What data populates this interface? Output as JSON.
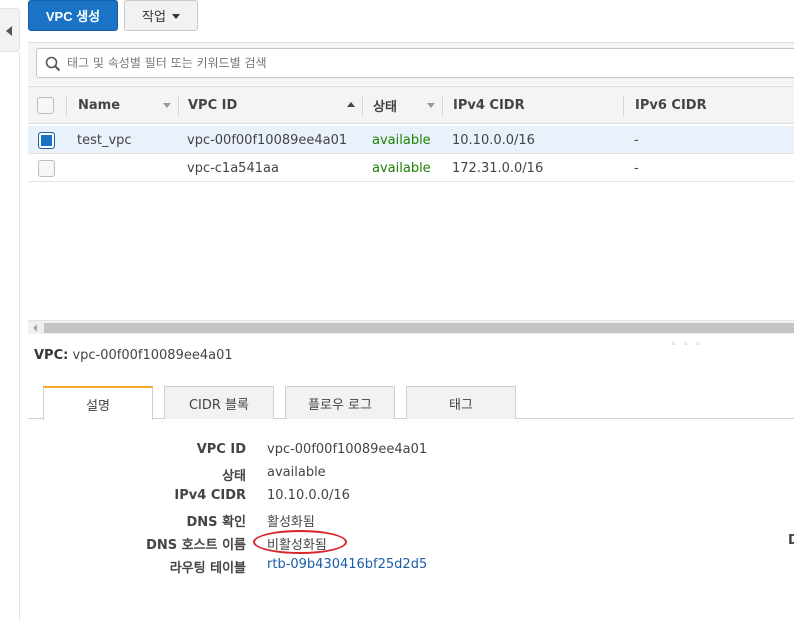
{
  "toolbar": {
    "create_vpc_label": "VPC 생성",
    "actions_label": "작업"
  },
  "search": {
    "placeholder": "태그 및 속성별 필터 또는 키워드별 검색"
  },
  "table": {
    "columns": [
      "Name",
      "VPC ID",
      "상태",
      "IPv4 CIDR",
      "IPv6 CIDR"
    ],
    "rows": [
      {
        "selected": true,
        "name": "test_vpc",
        "vpc_id": "vpc-00f00f10089ee4a01",
        "state": "available",
        "ipv4": "10.10.0.0/16",
        "ipv6": "-"
      },
      {
        "selected": false,
        "name": "",
        "vpc_id": "vpc-c1a541aa",
        "state": "available",
        "ipv4": "172.31.0.0/16",
        "ipv6": "-"
      }
    ]
  },
  "grip_text": "◦ ◦ ◦",
  "details": {
    "title_label": "VPC:",
    "title_value": "vpc-00f00f10089ee4a01",
    "tabs": [
      "설명",
      "CIDR 블록",
      "플로우 로그",
      "태그"
    ],
    "fields": [
      {
        "label": "VPC ID",
        "value": "vpc-00f00f10089ee4a01"
      },
      {
        "label": "상태",
        "value": "available"
      },
      {
        "label": "IPv4 CIDR",
        "value": "10.10.0.0/16"
      },
      {
        "label": "DNS 확인",
        "value": "활성화됨"
      },
      {
        "label": "DNS 호스트 이름",
        "value": "비활성화됨"
      },
      {
        "label": "라우팅 테이블",
        "value": "rtb-09b430416bf25d2d5"
      }
    ],
    "clipped_letter": "D"
  },
  "colors": {
    "primary": "#1a73c5",
    "available": "#1d8102",
    "link": "#1a5ea8",
    "annotation": "#d9232a",
    "active_tab_accent": "#f5a623"
  }
}
